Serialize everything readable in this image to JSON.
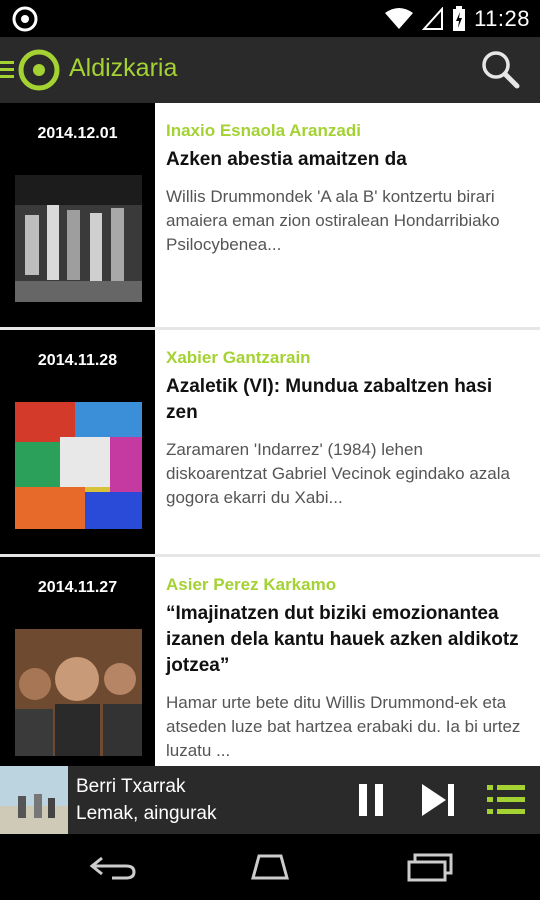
{
  "status": {
    "time": "11:28"
  },
  "appbar": {
    "title": "Aldizkaria"
  },
  "articles": [
    {
      "date": "2014.12.01",
      "author": "Inaxio Esnaola Aranzadi",
      "title": "Azken abestia amaitzen da",
      "excerpt": "Willis Drummondek 'A ala B' kontzertu birari amaiera eman zion ostiralean Hondarribiako Psilocybenea..."
    },
    {
      "date": "2014.11.28",
      "author": "Xabier Gantzarain",
      "title": "Azaletik (VI): Mundua zabaltzen hasi zen",
      "excerpt": "Zaramaren 'Indarrez' (1984) lehen diskoarentzat Gabriel Vecinok egindako azala gogora ekarri du Xabi..."
    },
    {
      "date": "2014.11.27",
      "author": "Asier Perez Karkamo",
      "title": "“Imajinatzen dut biziki emozionantea izanen dela kantu hauek azken aldikotz jotzea”",
      "excerpt": "Hamar urte bete ditu Willis Drummond-ek eta atseden luze bat hartzea erabaki du. Ia bi urtez luzatu ..."
    }
  ],
  "player": {
    "artist": "Berri Txarrak",
    "track": "Lemak, aingurak"
  },
  "colors": {
    "accent": "#a4d233",
    "bar": "#2a2a2a"
  }
}
